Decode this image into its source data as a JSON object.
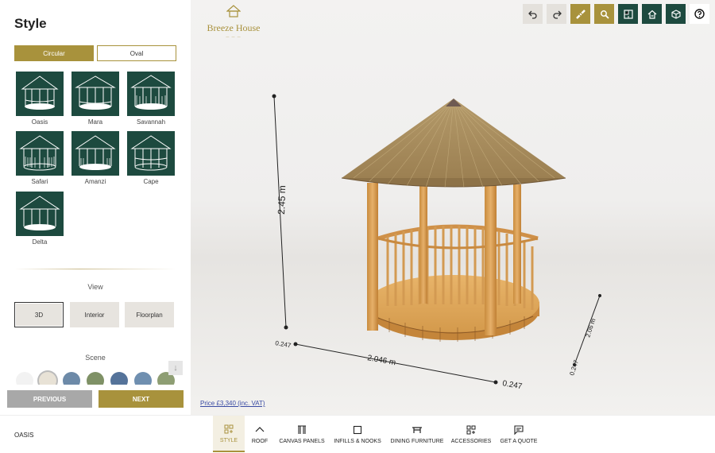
{
  "panel": {
    "title": "Style",
    "shapes": [
      "Circular",
      "Oval"
    ],
    "styles": [
      "Oasis",
      "Mara",
      "Savannah",
      "Safari",
      "Amanzi",
      "Cape",
      "Delta"
    ],
    "view_label": "View",
    "views": [
      "3D",
      "Interior",
      "Floorplan"
    ],
    "scene_label": "Scene",
    "previous_label": "PREVIOUS",
    "next_label": "NEXT"
  },
  "brand": {
    "name": "Breeze House",
    "accent": "#a8923c",
    "green": "#1d4a3f"
  },
  "viewport": {
    "height_label": "2.45 m",
    "width_label": "2.046 m",
    "width_end_label": "0.247",
    "width_start_label": "0.247",
    "depth_label": "2.06 m",
    "depth_end_label": "0.247",
    "price": "Price £3,340 (inc. VAT)"
  },
  "toolbar": {
    "icons": [
      "undo-icon",
      "redo-icon",
      "ruler-icon",
      "zoom-icon",
      "floorplan-icon",
      "home-icon",
      "cube-icon",
      "help-icon"
    ]
  },
  "bottom": {
    "selected_name": "OASIS",
    "tabs": [
      "STYLE",
      "ROOF",
      "CANVAS PANELS",
      "INFILLS & NOOKS",
      "DINING FURNITURE",
      "ACCESSORIES",
      "GET A QUOTE"
    ]
  }
}
